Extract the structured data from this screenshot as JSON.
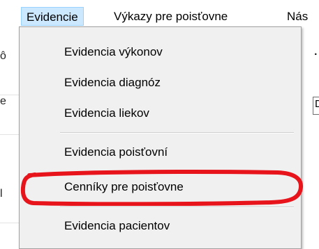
{
  "menubar": {
    "items": [
      {
        "label": "Evidencie"
      },
      {
        "label": "Výkazy pre poisťovne"
      },
      {
        "label": "Nás"
      }
    ]
  },
  "dropdown": {
    "items": [
      {
        "label": "Evidencia výkonov"
      },
      {
        "label": "Evidencia diagnóz"
      },
      {
        "label": "Evidencia liekov"
      },
      {
        "label": "Evidencia poisťovní"
      },
      {
        "label": "Cenníky pre poisťovne"
      },
      {
        "label": "Evidencia pacientov"
      }
    ]
  },
  "background": {
    "fragment_1": "ô",
    "fragment_2": "e",
    "fragment_3": "l",
    "fragment_4": "D"
  },
  "colors": {
    "highlight": "#cce8ff",
    "annotation": "#e8141c"
  }
}
